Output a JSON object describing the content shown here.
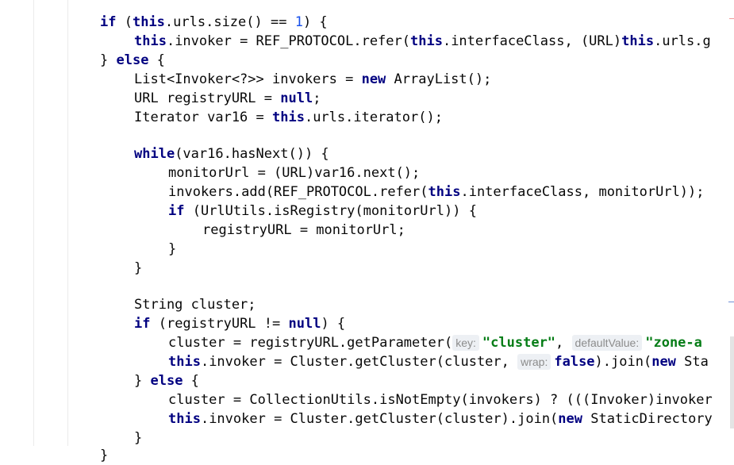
{
  "code": {
    "l1": {
      "kw_if": "if",
      "paren_open": " (",
      "kw_this": "this",
      "rest_a": ".urls.size() == ",
      "num_one": "1",
      "rest_b": ") {"
    },
    "l2": {
      "kw_this1": "this",
      "mid1": ".invoker = REF_PROTOCOL.refer(",
      "kw_this2": "this",
      "mid2": ".interfaceClass, (URL)",
      "kw_this3": "this",
      "tail": ".urls.g"
    },
    "l3": {
      "brace": "} ",
      "kw_else": "else",
      "open": " {"
    },
    "l4": {
      "pre": "List<Invoker<?>> invokers = ",
      "kw_new": "new",
      "post": " ArrayList();"
    },
    "l5": {
      "pre": "URL registryURL = ",
      "kw_null": "null",
      "post": ";"
    },
    "l6": {
      "pre": "Iterator var16 = ",
      "kw_this": "this",
      "post": ".urls.iterator();"
    },
    "l7": {
      "kw_while": "while",
      "post": "(var16.hasNext()) {"
    },
    "l8": {
      "text": "monitorUrl = (URL)var16.next();"
    },
    "l9": {
      "pre": "invokers.add(REF_PROTOCOL.refer(",
      "kw_this": "this",
      "post": ".interfaceClass, monitorUrl));"
    },
    "l10": {
      "kw_if": "if",
      "post": " (UrlUtils.isRegistry(monitorUrl)) {"
    },
    "l11": {
      "text": "registryURL = monitorUrl;"
    },
    "l12": {
      "text": "}"
    },
    "l13": {
      "text": "}"
    },
    "l14": {
      "text": "String cluster;"
    },
    "l15": {
      "kw_if": "if",
      "pre": " (registryURL != ",
      "kw_null": "null",
      "post": ") {"
    },
    "l16": {
      "pre": "cluster = registryURL.getParameter(",
      "hint_key": "key:",
      "str_key": "\"cluster\"",
      "comma": ", ",
      "hint_default": "defaultValue:",
      "str_default": "\"zone-a"
    },
    "l17": {
      "kw_this": "this",
      "pre": ".invoker = Cluster.getCluster(cluster, ",
      "hint_wrap": "wrap:",
      "kw_false": "false",
      "mid": ").join(",
      "kw_new": "new",
      "tail": " Sta"
    },
    "l18": {
      "brace": "} ",
      "kw_else": "else",
      "open": " {"
    },
    "l19": {
      "text": "cluster = CollectionUtils.isNotEmpty(invokers) ? (((Invoker)invoker"
    },
    "l20": {
      "kw_this": "this",
      "pre": ".invoker = Cluster.getCluster(cluster).join(",
      "kw_new": "new",
      "tail": " StaticDirectory"
    },
    "l21": {
      "text": "}"
    },
    "l22": {
      "text": "}"
    }
  },
  "colors": {
    "keyword": "#0033b3",
    "number": "#1750eb",
    "string": "#067d17",
    "hint_bg": "#edf0f4",
    "hint_fg": "#8c8c8c"
  }
}
